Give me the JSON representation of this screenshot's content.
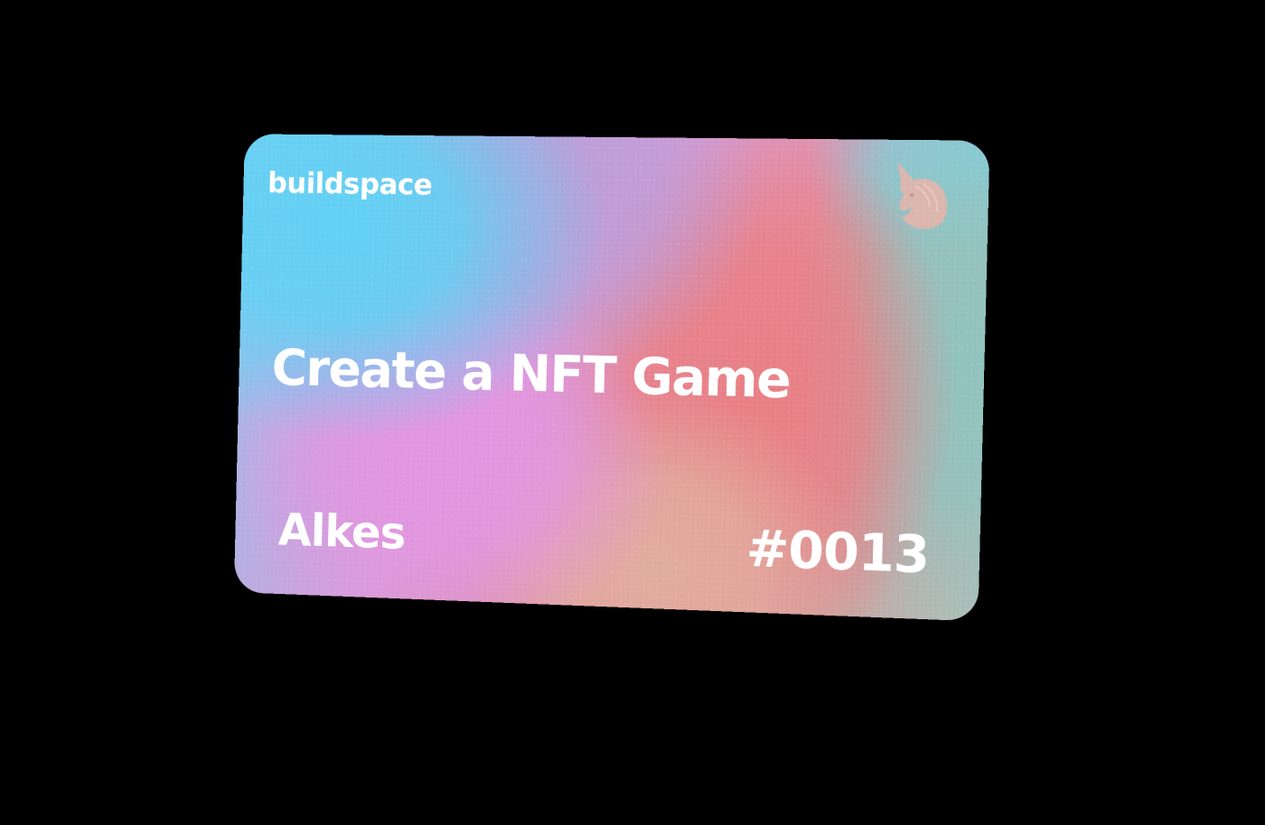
{
  "card": {
    "brand": "buildspace",
    "title": "Create a NFT Game",
    "owner_name": "Alkes",
    "serial_number": "#0013",
    "logo_icon": "unicorn-icon"
  },
  "colors": {
    "background": "#000000",
    "text": "#ffffff",
    "gradient_cyan": "#5fd0f4",
    "gradient_pink": "#e294e0",
    "gradient_lavender": "#bc9bd6",
    "gradient_coral": "#e87e84",
    "gradient_peach": "#e0ab9e",
    "gradient_teal": "#8fc3be",
    "logo_tint": "#e7b3a8"
  }
}
